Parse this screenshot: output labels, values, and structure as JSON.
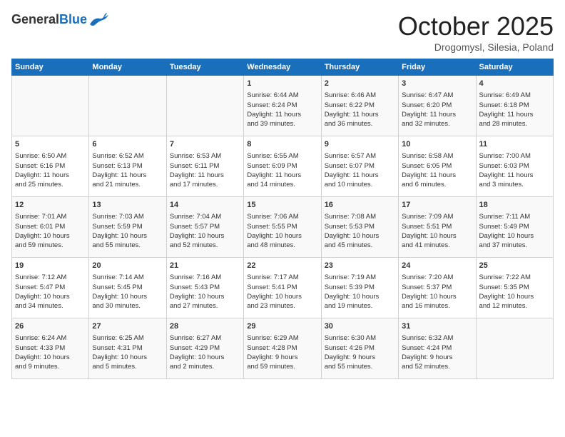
{
  "header": {
    "logo_general": "General",
    "logo_blue": "Blue",
    "month_title": "October 2025",
    "location": "Drogomysl, Silesia, Poland"
  },
  "days_of_week": [
    "Sunday",
    "Monday",
    "Tuesday",
    "Wednesday",
    "Thursday",
    "Friday",
    "Saturday"
  ],
  "weeks": [
    [
      {
        "day": "",
        "info": ""
      },
      {
        "day": "",
        "info": ""
      },
      {
        "day": "",
        "info": ""
      },
      {
        "day": "1",
        "info": "Sunrise: 6:44 AM\nSunset: 6:24 PM\nDaylight: 11 hours\nand 39 minutes."
      },
      {
        "day": "2",
        "info": "Sunrise: 6:46 AM\nSunset: 6:22 PM\nDaylight: 11 hours\nand 36 minutes."
      },
      {
        "day": "3",
        "info": "Sunrise: 6:47 AM\nSunset: 6:20 PM\nDaylight: 11 hours\nand 32 minutes."
      },
      {
        "day": "4",
        "info": "Sunrise: 6:49 AM\nSunset: 6:18 PM\nDaylight: 11 hours\nand 28 minutes."
      }
    ],
    [
      {
        "day": "5",
        "info": "Sunrise: 6:50 AM\nSunset: 6:16 PM\nDaylight: 11 hours\nand 25 minutes."
      },
      {
        "day": "6",
        "info": "Sunrise: 6:52 AM\nSunset: 6:13 PM\nDaylight: 11 hours\nand 21 minutes."
      },
      {
        "day": "7",
        "info": "Sunrise: 6:53 AM\nSunset: 6:11 PM\nDaylight: 11 hours\nand 17 minutes."
      },
      {
        "day": "8",
        "info": "Sunrise: 6:55 AM\nSunset: 6:09 PM\nDaylight: 11 hours\nand 14 minutes."
      },
      {
        "day": "9",
        "info": "Sunrise: 6:57 AM\nSunset: 6:07 PM\nDaylight: 11 hours\nand 10 minutes."
      },
      {
        "day": "10",
        "info": "Sunrise: 6:58 AM\nSunset: 6:05 PM\nDaylight: 11 hours\nand 6 minutes."
      },
      {
        "day": "11",
        "info": "Sunrise: 7:00 AM\nSunset: 6:03 PM\nDaylight: 11 hours\nand 3 minutes."
      }
    ],
    [
      {
        "day": "12",
        "info": "Sunrise: 7:01 AM\nSunset: 6:01 PM\nDaylight: 10 hours\nand 59 minutes."
      },
      {
        "day": "13",
        "info": "Sunrise: 7:03 AM\nSunset: 5:59 PM\nDaylight: 10 hours\nand 55 minutes."
      },
      {
        "day": "14",
        "info": "Sunrise: 7:04 AM\nSunset: 5:57 PM\nDaylight: 10 hours\nand 52 minutes."
      },
      {
        "day": "15",
        "info": "Sunrise: 7:06 AM\nSunset: 5:55 PM\nDaylight: 10 hours\nand 48 minutes."
      },
      {
        "day": "16",
        "info": "Sunrise: 7:08 AM\nSunset: 5:53 PM\nDaylight: 10 hours\nand 45 minutes."
      },
      {
        "day": "17",
        "info": "Sunrise: 7:09 AM\nSunset: 5:51 PM\nDaylight: 10 hours\nand 41 minutes."
      },
      {
        "day": "18",
        "info": "Sunrise: 7:11 AM\nSunset: 5:49 PM\nDaylight: 10 hours\nand 37 minutes."
      }
    ],
    [
      {
        "day": "19",
        "info": "Sunrise: 7:12 AM\nSunset: 5:47 PM\nDaylight: 10 hours\nand 34 minutes."
      },
      {
        "day": "20",
        "info": "Sunrise: 7:14 AM\nSunset: 5:45 PM\nDaylight: 10 hours\nand 30 minutes."
      },
      {
        "day": "21",
        "info": "Sunrise: 7:16 AM\nSunset: 5:43 PM\nDaylight: 10 hours\nand 27 minutes."
      },
      {
        "day": "22",
        "info": "Sunrise: 7:17 AM\nSunset: 5:41 PM\nDaylight: 10 hours\nand 23 minutes."
      },
      {
        "day": "23",
        "info": "Sunrise: 7:19 AM\nSunset: 5:39 PM\nDaylight: 10 hours\nand 19 minutes."
      },
      {
        "day": "24",
        "info": "Sunrise: 7:20 AM\nSunset: 5:37 PM\nDaylight: 10 hours\nand 16 minutes."
      },
      {
        "day": "25",
        "info": "Sunrise: 7:22 AM\nSunset: 5:35 PM\nDaylight: 10 hours\nand 12 minutes."
      }
    ],
    [
      {
        "day": "26",
        "info": "Sunrise: 6:24 AM\nSunset: 4:33 PM\nDaylight: 10 hours\nand 9 minutes."
      },
      {
        "day": "27",
        "info": "Sunrise: 6:25 AM\nSunset: 4:31 PM\nDaylight: 10 hours\nand 5 minutes."
      },
      {
        "day": "28",
        "info": "Sunrise: 6:27 AM\nSunset: 4:29 PM\nDaylight: 10 hours\nand 2 minutes."
      },
      {
        "day": "29",
        "info": "Sunrise: 6:29 AM\nSunset: 4:28 PM\nDaylight: 9 hours\nand 59 minutes."
      },
      {
        "day": "30",
        "info": "Sunrise: 6:30 AM\nSunset: 4:26 PM\nDaylight: 9 hours\nand 55 minutes."
      },
      {
        "day": "31",
        "info": "Sunrise: 6:32 AM\nSunset: 4:24 PM\nDaylight: 9 hours\nand 52 minutes."
      },
      {
        "day": "",
        "info": ""
      }
    ]
  ]
}
